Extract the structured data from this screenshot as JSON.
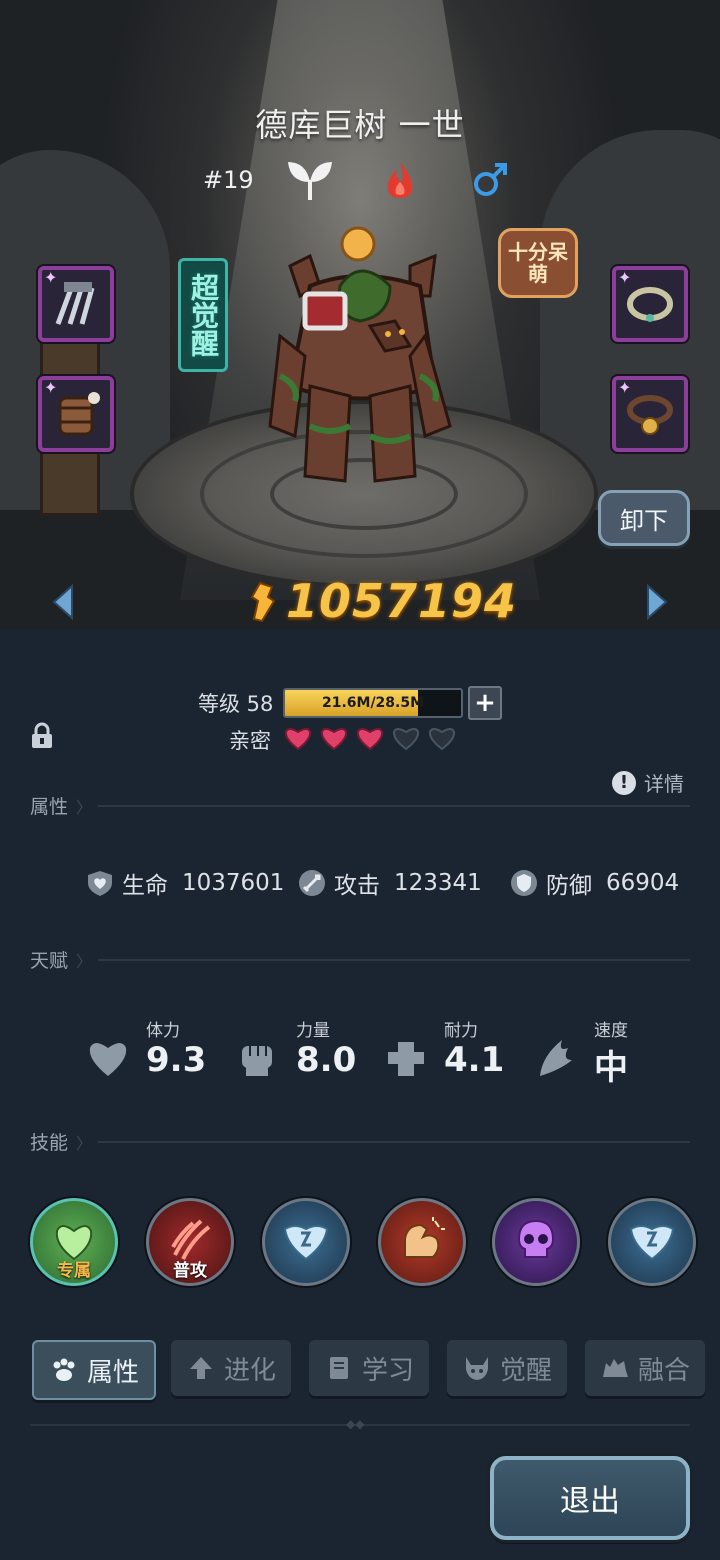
{
  "pet": {
    "name": "德库巨树 一世",
    "number": "#19",
    "awaken_badge": "超觉醒",
    "trait_badge": "十分呆萌",
    "power": "1057194",
    "unequip_label": "卸下"
  },
  "level": {
    "label": "等级 58",
    "exp_text": "21.6M/28.5M",
    "exp_fraction": 0.758
  },
  "intimacy": {
    "label": "亲密",
    "filled_hearts": 3,
    "total_hearts": 5
  },
  "detail_label": "详情",
  "sections": {
    "attributes": "属性",
    "talent": "天赋",
    "skills": "技能"
  },
  "stats": [
    {
      "label": "生命",
      "value": "1037601",
      "icon": "heart-shield-icon"
    },
    {
      "label": "攻击",
      "value": "123341",
      "icon": "sword-icon"
    },
    {
      "label": "防御",
      "value": "66904",
      "icon": "shield-icon"
    }
  ],
  "talents": [
    {
      "label": "体力",
      "value": "9.3",
      "icon": "heart-icon"
    },
    {
      "label": "力量",
      "value": "8.0",
      "icon": "fist-icon"
    },
    {
      "label": "耐力",
      "value": "4.1",
      "icon": "muscle-icon"
    },
    {
      "label": "速度",
      "value": "中",
      "icon": "wing-icon"
    }
  ],
  "skills": [
    {
      "label": "专属",
      "icon": "heart-leaf-icon"
    },
    {
      "label": "普攻",
      "icon": "claw-slash-icon"
    },
    {
      "label": "",
      "icon": "wing-shield-icon"
    },
    {
      "label": "",
      "icon": "flex-arm-icon"
    },
    {
      "label": "",
      "icon": "purple-skull-icon"
    },
    {
      "label": "",
      "icon": "wing-shield-icon"
    }
  ],
  "tabs": [
    {
      "label": "属性",
      "icon": "paw-icon",
      "active": true
    },
    {
      "label": "进化",
      "icon": "up-arrow-icon",
      "active": false
    },
    {
      "label": "学习",
      "icon": "book-icon",
      "active": false
    },
    {
      "label": "觉醒",
      "icon": "horned-mask-icon",
      "active": false
    },
    {
      "label": "融合",
      "icon": "beast-icon",
      "active": false
    }
  ],
  "exit_label": "退出",
  "colors": {
    "power": "#f7c44a",
    "exp_fill": "#e8b83a",
    "heart_filled": "#e0406a",
    "heart_empty": "#2a333d",
    "panel_bg": "#1b2531"
  }
}
